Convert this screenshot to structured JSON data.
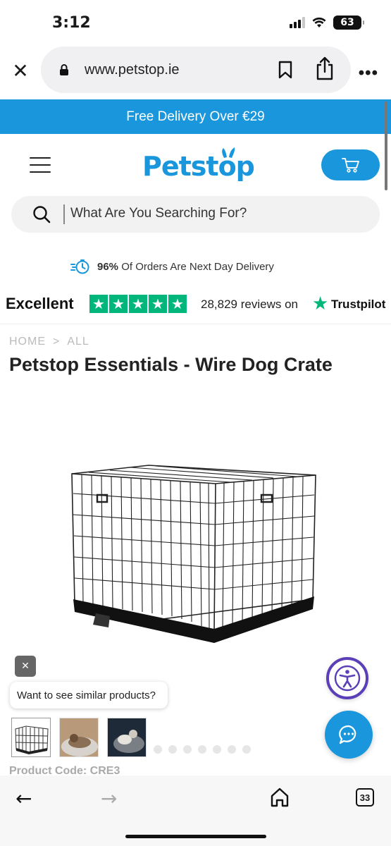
{
  "status_bar": {
    "time": "3:12",
    "battery": "63"
  },
  "browser": {
    "url": "www.petstop.ie",
    "tab_count": "33"
  },
  "promo": {
    "text": "Free Delivery Over €29"
  },
  "header": {
    "logo": "Petstop"
  },
  "search": {
    "placeholder": "What Are You Searching For?"
  },
  "delivery": {
    "percent": "96%",
    "text": "Of Orders Are Next Day Delivery"
  },
  "trustpilot": {
    "rating_word": "Excellent",
    "stars": 5,
    "reviews": "28,829 reviews on",
    "brand": "Trustpilot"
  },
  "breadcrumb": {
    "home": "HOME",
    "separator": ">",
    "current": "ALL"
  },
  "product": {
    "title": "Petstop Essentials - Wire Dog Crate",
    "code": "Product Code: CRE3",
    "gallery_dots": 7
  },
  "similar": {
    "label": "Want to see similar products?"
  },
  "colors": {
    "brand": "#1a97dc",
    "trustpilot_green": "#00b67a",
    "accessibility": "#5a3fb8"
  }
}
